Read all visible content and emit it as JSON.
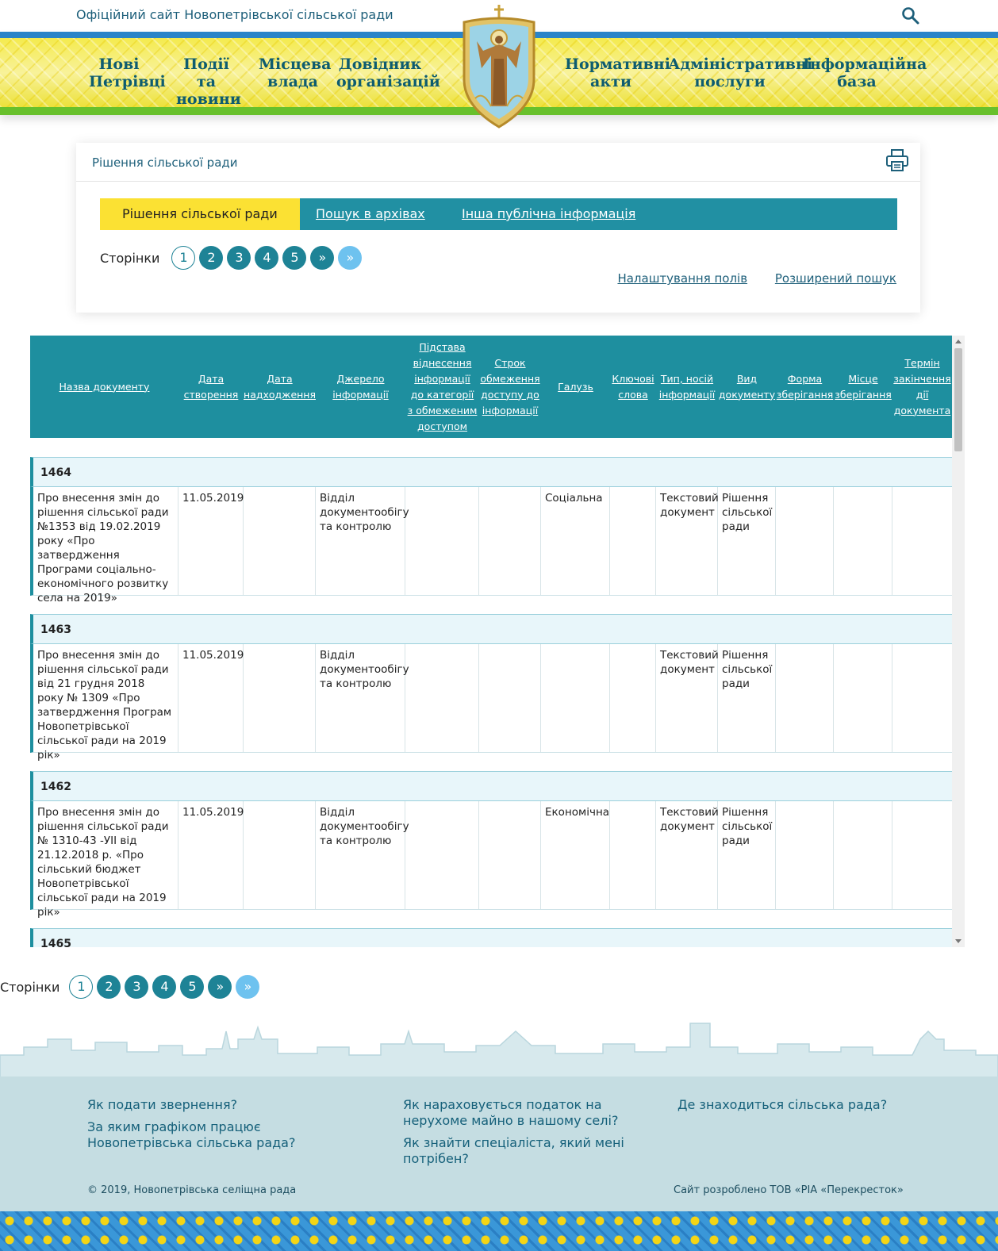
{
  "site": {
    "title": "Офіційний сайт Новопетрівської сільської ради"
  },
  "nav": {
    "left": [
      "Нові\nПетрівці",
      "Події та\nновини",
      "Місцева\nвлада",
      "Довідник\nорганізацій"
    ],
    "right": [
      "Нормативні\nакти",
      "Адміністративні\nпослуги",
      "Інформаційна\nбаза"
    ]
  },
  "card": {
    "title": "Рішення сільської ради",
    "tabs": [
      "Рішення сільської ради",
      "Пошук в архівах",
      "Інша публічна інформація"
    ],
    "pager_label": "Сторінки",
    "pages": [
      "1",
      "2",
      "3",
      "4",
      "5",
      "»",
      "»"
    ],
    "links": [
      "Налаштування полів",
      "Розширений пошук"
    ]
  },
  "table": {
    "headers": [
      "Назва документу",
      "Дата створення",
      "Дата надходження",
      "Джерело інформації",
      "Підстава віднесення інформації до категорії з обмеженим доступом",
      "Строк обмеження доступу до інформації",
      "Галузь",
      "Ключові слова",
      "Тип, носій інформації",
      "Вид документу",
      "Форма зберігання",
      "Місце зберігання",
      "Термін закінчення дії документа"
    ],
    "records": [
      {
        "id": "1464",
        "cells": [
          "Про внесення змін до рішення сільської ради №1353 від 19.02.2019 року «Про затвердження Програми соціально-економічного розвитку села на 2019»",
          "11.05.2019",
          "",
          "Відділ документообігу та контролю",
          "",
          "",
          "Соціальна",
          "",
          "Текстовий документ",
          "Рішення сільської ради",
          "",
          "",
          ""
        ]
      },
      {
        "id": "1463",
        "cells": [
          "Про внесення змін до рішення сільської ради від 21 грудня 2018 року № 1309 «Про затвердження Програм Новопетрівської сільської ради на 2019 рік»",
          "11.05.2019",
          "",
          "Відділ документообігу та контролю",
          "",
          "",
          "",
          "",
          "Текстовий документ",
          "Рішення сільської ради",
          "",
          "",
          ""
        ]
      },
      {
        "id": "1462",
        "cells": [
          "Про внесення змін до рішення сільської ради № 1310-43 -УІІ від 21.12.2018 р. «Про сільський бюджет Новопетрівської сільської ради на 2019 рік»",
          "11.05.2019",
          "",
          "Відділ документообігу та контролю",
          "",
          "",
          "Економічна",
          "",
          "Текстовий документ",
          "Рішення сільської ради",
          "",
          "",
          ""
        ]
      },
      {
        "id": "1465"
      }
    ]
  },
  "footer": {
    "links": [
      "Як подати звернення?",
      "За яким графіком працює Новопетрівська сільська рада?",
      "Як нараховується податок на нерухоме майно в нашому селі?",
      "Як знайти спеціаліста, який мені потрібен?",
      "Де знаходиться сільська рада?"
    ],
    "copyright": "© 2019, Новопетрівська селіщна рада",
    "developer": "Сайт розроблено ТОВ «РІА «Перекресток»"
  },
  "icons": {
    "search": "search-icon",
    "print": "printer-icon",
    "emblem": "emblem-icon"
  },
  "colors": {
    "accent": "#1e8f9f",
    "tab_active": "#fbe133",
    "nav_text": "#0e5c6f",
    "footer_bg": "#c5dde2"
  }
}
